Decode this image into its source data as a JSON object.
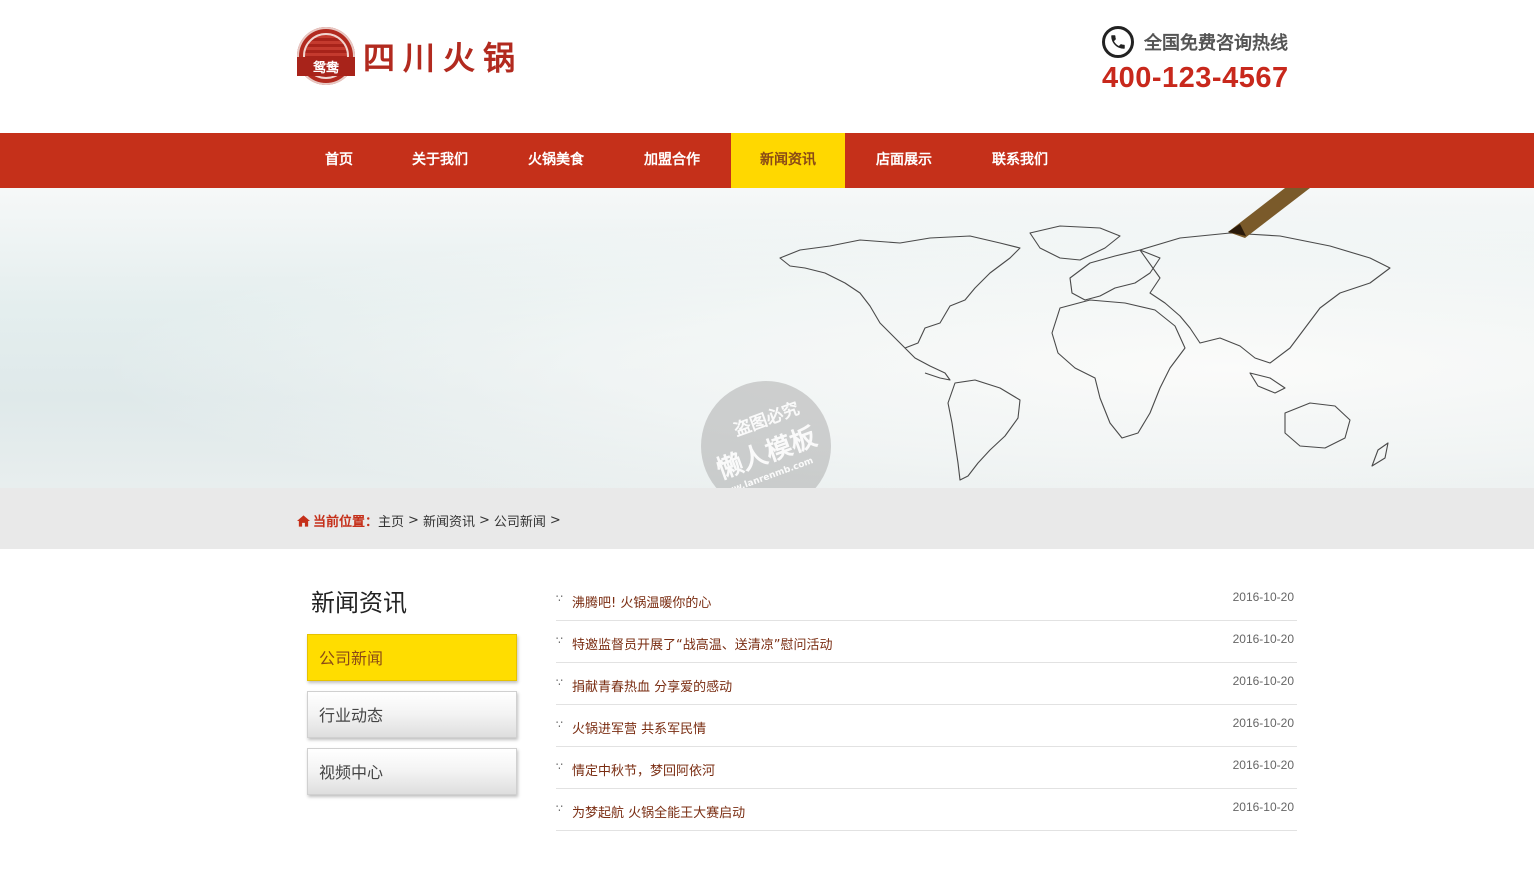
{
  "brand": {
    "seal_text": "鸳鸯",
    "name": "四川火锅"
  },
  "hotline": {
    "label": "全国免费咨询热线",
    "number": "400-123-4567"
  },
  "nav": {
    "items": [
      {
        "label": "首页"
      },
      {
        "label": "关于我们"
      },
      {
        "label": "火锅美食"
      },
      {
        "label": "加盟合作"
      },
      {
        "label": "新闻资讯"
      },
      {
        "label": "店面展示"
      },
      {
        "label": "联系我们"
      }
    ],
    "active": "新闻资讯"
  },
  "watermark": {
    "line1": "盗图必究",
    "line2": "懒人模板",
    "line3": "www.lanrenmb.com"
  },
  "breadcrumb": {
    "label": "当前位置：",
    "items": [
      "主页",
      "新闻资讯",
      "公司新闻"
    ],
    "separator": ">"
  },
  "sidebar": {
    "title": "新闻资讯",
    "items": [
      {
        "label": "公司新闻"
      },
      {
        "label": "行业动态"
      },
      {
        "label": "视频中心"
      }
    ],
    "active": "公司新闻"
  },
  "news": {
    "bullet": "∵",
    "items": [
      {
        "title": "沸腾吧! 火锅温暖你的心",
        "date": "2016-10-20"
      },
      {
        "title": "特邀监督员开展了“战高温、送清凉”慰问活动",
        "date": "2016-10-20"
      },
      {
        "title": "捐献青春热血 分享爱的感动",
        "date": "2016-10-20"
      },
      {
        "title": "火锅进军营 共系军民情",
        "date": "2016-10-20"
      },
      {
        "title": "情定中秋节，梦回阿依河",
        "date": "2016-10-20"
      },
      {
        "title": "为梦起航 火锅全能王大赛启动",
        "date": "2016-10-20"
      }
    ]
  },
  "colors": {
    "brand_red": "#c5301a",
    "active_yellow": "#ffd800",
    "hotline_red": "#c8281c"
  }
}
